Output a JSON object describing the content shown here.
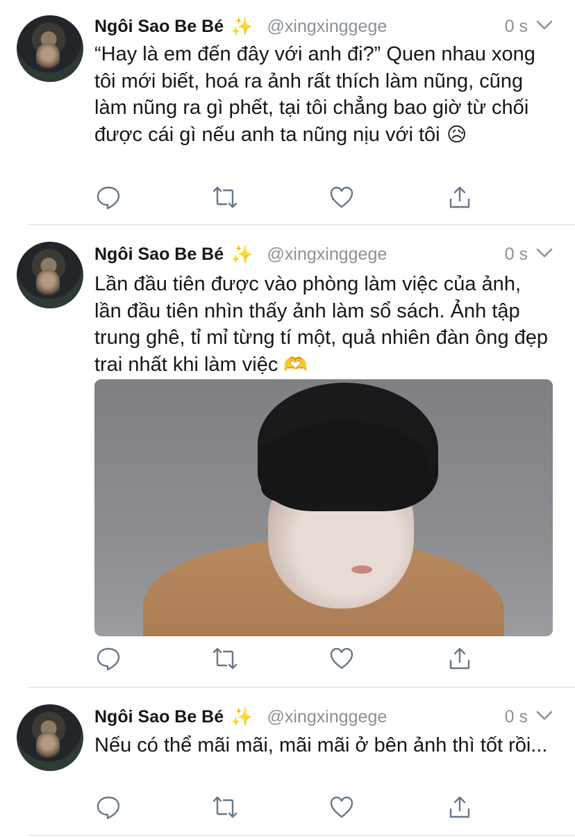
{
  "tweets": [
    {
      "author_name": "Ngôi Sao Be Bé",
      "sparkle_icon": "✨",
      "handle": "@xingxinggege",
      "time": "0 s",
      "text": "“Hay là em đến đây với anh đi?” Quen nhau xong tôi mới biết, hoá ra ảnh rất thích làm nũng, cũng làm nũng ra gì phết, tại tôi chẳng bao giờ từ chối được cái gì nếu anh ta nũng nịu với tôi",
      "emoji": "😥"
    },
    {
      "author_name": "Ngôi Sao Be Bé",
      "sparkle_icon": "✨",
      "handle": "@xingxinggege",
      "time": "0 s",
      "text": "Lần đầu tiên được vào phòng làm việc của ảnh, lần đầu tiên nhìn thấy ảnh làm sổ sách. Ảnh tập trung ghê, tỉ mỉ từng tí một, quả nhiên đàn ông đẹp trai nhất khi làm việc",
      "emoji": "🫶"
    },
    {
      "author_name": "Ngôi Sao Be Bé",
      "sparkle_icon": "✨",
      "handle": "@xingxinggege",
      "time": "0 s",
      "text": "Nếu có thể mãi mãi, mãi mãi ở bên ảnh thì tốt rồi..."
    }
  ],
  "icons": [
    "reply-icon",
    "retweet-icon",
    "like-icon",
    "share-icon",
    "chevron-down-icon"
  ],
  "colors": {
    "text": "#14171a",
    "secondary": "#8a9199",
    "icon": "#667788",
    "divider": "#d9dde0"
  }
}
